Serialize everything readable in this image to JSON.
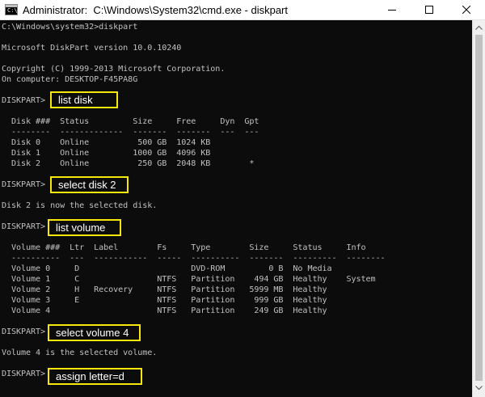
{
  "window": {
    "title": "Administrator:  C:\\Windows\\System32\\cmd.exe - diskpart",
    "icon": "cmd-icon",
    "icon_glyph": "C:\\",
    "controls": [
      "minimize-icon",
      "maximize-icon",
      "close-icon"
    ]
  },
  "console": {
    "lines": [
      "C:\\Windows\\system32>diskpart",
      "",
      "Microsoft DiskPart version 10.0.10240",
      "",
      "Copyright (C) 1999-2013 Microsoft Corporation.",
      "On computer: DESKTOP-F45PA8G",
      "",
      "DISKPART>",
      "",
      "  Disk ###  Status         Size     Free     Dyn  Gpt",
      "  --------  -------------  -------  -------  ---  ---",
      "  Disk 0    Online          500 GB  1024 KB",
      "  Disk 1    Online         1000 GB  4096 KB",
      "  Disk 2    Online          250 GB  2048 KB        *",
      "",
      "DISKPART>",
      "",
      "Disk 2 is now the selected disk.",
      "",
      "DISKPART>",
      "",
      "  Volume ###  Ltr  Label        Fs     Type        Size     Status     Info",
      "  ----------  ---  -----------  -----  ----------  -------  ---------  --------",
      "  Volume 0     D                       DVD-ROM         0 B  No Media",
      "  Volume 1     C                NTFS   Partition    494 GB  Healthy    System",
      "  Volume 2     H   Recovery     NTFS   Partition   5999 MB  Healthy",
      "  Volume 3     E                NTFS   Partition    999 GB  Healthy",
      "  Volume 4                      NTFS   Partition    249 GB  Healthy",
      "",
      "DISKPART>",
      "",
      "Volume 4 is the selected volume.",
      "",
      "DISKPART>"
    ]
  },
  "callouts": [
    {
      "text": "list disk"
    },
    {
      "text": "select disk 2"
    },
    {
      "text": "list volume"
    },
    {
      "text": "select volume 4"
    },
    {
      "text": "assign letter=d"
    }
  ],
  "colors": {
    "console_background": "#0c0c0c",
    "console_text": "#c0c0c0",
    "callout_border": "#f7e70a",
    "callout_text": "#ffffff"
  }
}
